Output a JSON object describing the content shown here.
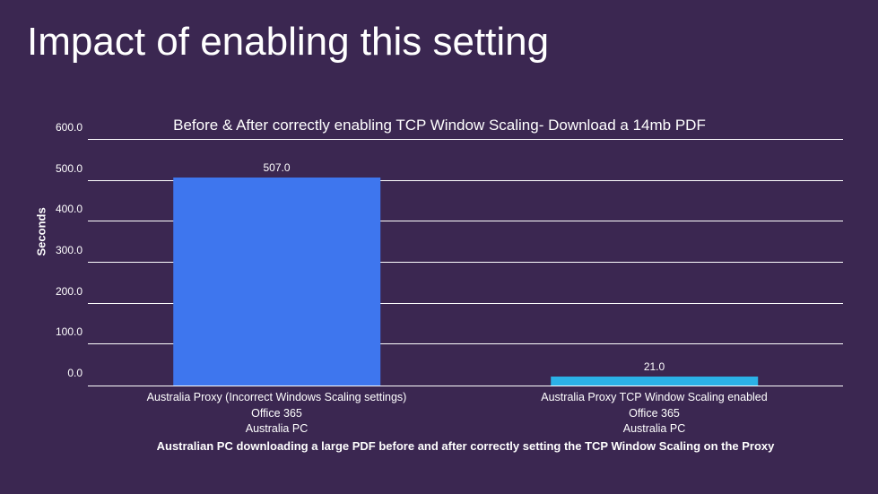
{
  "slide": {
    "title": "Impact of enabling this setting"
  },
  "chart_data": {
    "type": "bar",
    "title": "Before & After correctly enabling TCP Window Scaling- Download a 14mb PDF",
    "ylabel": "Seconds",
    "xlabel": "",
    "ylim": [
      0,
      600
    ],
    "yticks": [
      "0.0",
      "100.0",
      "200.0",
      "300.0",
      "400.0",
      "500.0",
      "600.0"
    ],
    "categories": [
      {
        "line1": "Australia Proxy (Incorrect Windows Scaling settings)",
        "line2": "Office 365",
        "line3": "Australia PC"
      },
      {
        "line1": "Australia Proxy TCP Window Scaling enabled",
        "line2": "Office 365",
        "line3": "Australia PC"
      }
    ],
    "values": [
      507.0,
      21.0
    ],
    "value_labels": [
      "507.0",
      "21.0"
    ],
    "caption": "Australian PC downloading a large PDF before and after correctly setting the TCP Window Scaling on the Proxy"
  }
}
